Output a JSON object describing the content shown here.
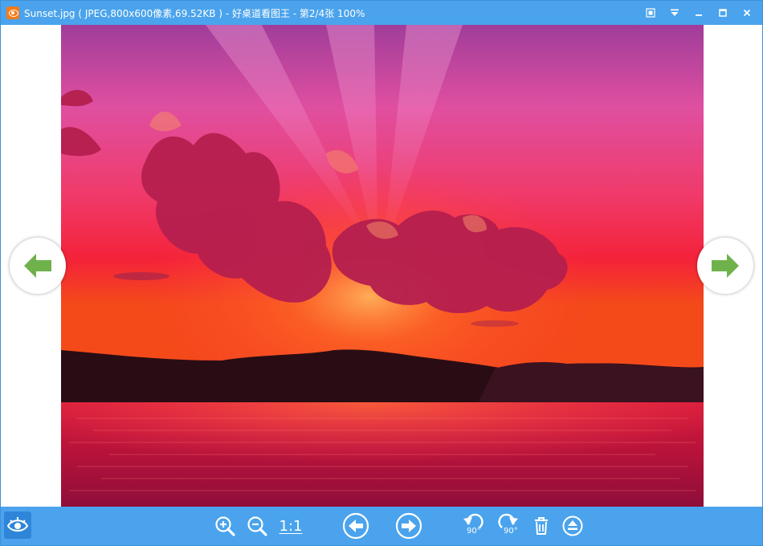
{
  "window": {
    "title": "Sunset.jpg ( JPEG,800x600像素,69.52KB ) - 好桌道看图王 - 第2/4张 100%"
  },
  "toolbar": {
    "actual_size_label": "1:1",
    "rotate_left_degrees": "90°",
    "rotate_right_degrees": "90°"
  },
  "colors": {
    "chrome": "#4aa3ec",
    "arrow": "#6fb24c"
  },
  "icons": [
    "app-logo-icon",
    "fullscreen-icon",
    "menu-dropdown-icon",
    "minimize-icon",
    "maximize-icon",
    "close-icon",
    "zoom-in-icon",
    "zoom-out-icon",
    "previous-image-icon",
    "next-image-icon",
    "rotate-left-icon",
    "rotate-right-icon",
    "delete-icon",
    "eject-icon"
  ]
}
